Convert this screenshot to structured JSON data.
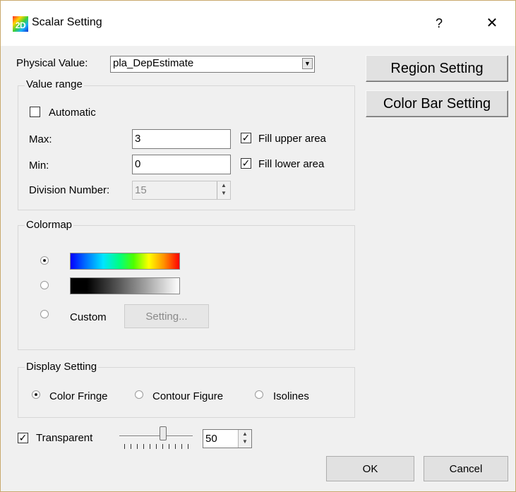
{
  "window": {
    "title": "Scalar Setting",
    "help_glyph": "?",
    "close_glyph": "✕",
    "icon_text": "2D"
  },
  "physical_value": {
    "label": "Physical Value:",
    "selected": "pla_DepEstimate"
  },
  "buttons": {
    "region_setting": "Region Setting",
    "color_bar_setting": "Color Bar Setting",
    "ok": "OK",
    "cancel": "Cancel"
  },
  "value_range": {
    "title": "Value range",
    "automatic_label": "Automatic",
    "automatic_checked": false,
    "max_label": "Max:",
    "max_value": "3",
    "min_label": "Min:",
    "min_value": "0",
    "fill_upper_label": "Fill upper area",
    "fill_upper_checked": true,
    "fill_lower_label": "Fill lower area",
    "fill_lower_checked": true,
    "division_label": "Division Number:",
    "division_value": "15"
  },
  "colormap": {
    "title": "Colormap",
    "selected": "rainbow",
    "custom_label": "Custom",
    "setting_label": "Setting..."
  },
  "display_setting": {
    "title": "Display Setting",
    "options": [
      "Color Fringe",
      "Contour Figure",
      "Isolines"
    ],
    "selected": "Color Fringe"
  },
  "transparent": {
    "label": "Transparent",
    "checked": true,
    "value": "50"
  },
  "colors": {
    "window_border": "#c9a96e",
    "dialog_bg": "#f0f0f0"
  }
}
